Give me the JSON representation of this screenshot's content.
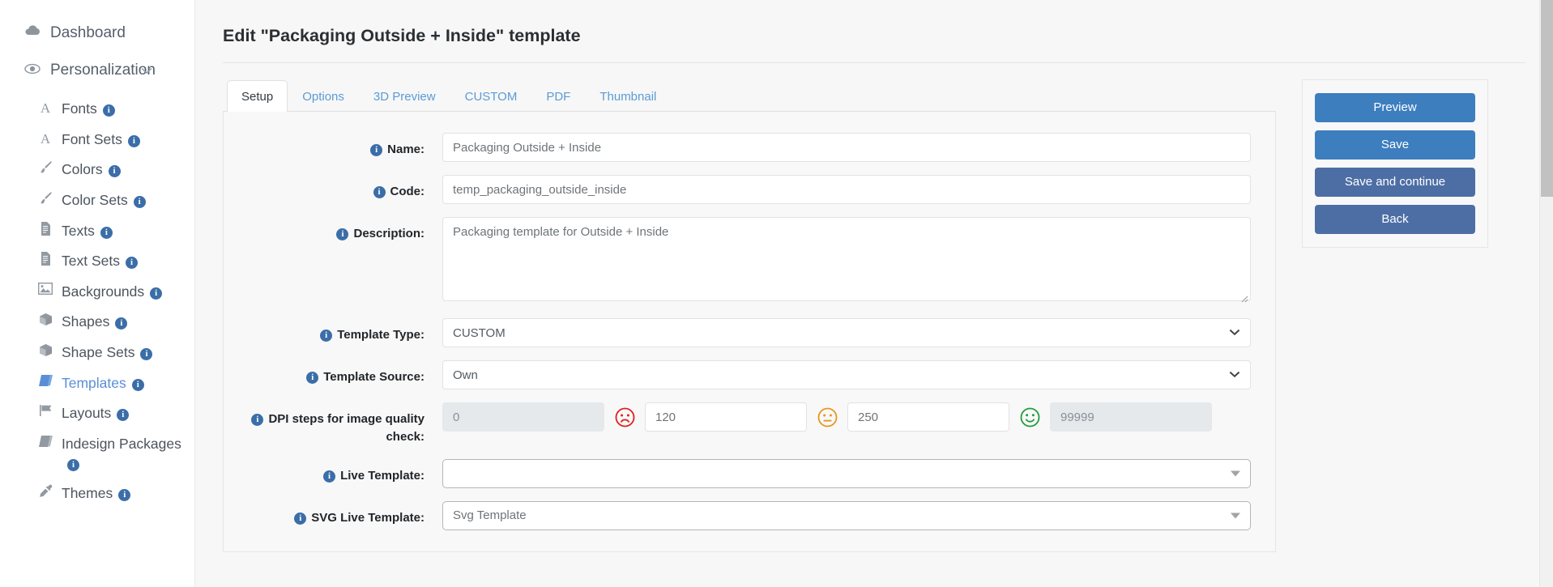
{
  "sidebar": {
    "dashboard": {
      "label": "Dashboard",
      "icon": "cloud-icon"
    },
    "personalization": {
      "label": "Personalization",
      "icon": "eye-icon",
      "chevron": "chevron-down-icon"
    },
    "items": [
      {
        "label": "Fonts",
        "icon": "font-letter-icon",
        "info": true,
        "active": false
      },
      {
        "label": "Font Sets",
        "icon": "font-letter-icon",
        "info": true,
        "active": false
      },
      {
        "label": "Colors",
        "icon": "brush-icon",
        "info": true,
        "active": false
      },
      {
        "label": "Color Sets",
        "icon": "brush-icon",
        "info": true,
        "active": false
      },
      {
        "label": "Texts",
        "icon": "document-icon",
        "info": true,
        "active": false
      },
      {
        "label": "Text Sets",
        "icon": "document-icon",
        "info": true,
        "active": false
      },
      {
        "label": "Backgrounds",
        "icon": "image-icon",
        "info": true,
        "active": false
      },
      {
        "label": "Shapes",
        "icon": "cube-icon",
        "info": true,
        "active": false
      },
      {
        "label": "Shape Sets",
        "icon": "cube-icon",
        "info": true,
        "active": false
      },
      {
        "label": "Templates",
        "icon": "book-icon",
        "info": true,
        "active": true
      },
      {
        "label": "Layouts",
        "icon": "flag-icon",
        "info": true,
        "active": false
      },
      {
        "label": "Indesign Packages",
        "icon": "book-icon",
        "info": true,
        "active": false
      },
      {
        "label": "Themes",
        "icon": "eyedropper-icon",
        "info": true,
        "active": false
      }
    ]
  },
  "header": {
    "title": "Edit \"Packaging Outside + Inside\" template"
  },
  "tabs": [
    {
      "label": "Setup",
      "active": true
    },
    {
      "label": "Options",
      "active": false
    },
    {
      "label": "3D Preview",
      "active": false
    },
    {
      "label": "CUSTOM",
      "active": false
    },
    {
      "label": "PDF",
      "active": false
    },
    {
      "label": "Thumbnail",
      "active": false
    }
  ],
  "form": {
    "name": {
      "label": "Name:",
      "value": "Packaging Outside + Inside"
    },
    "code": {
      "label": "Code:",
      "value": "temp_packaging_outside_inside"
    },
    "description": {
      "label": "Description:",
      "value": "Packaging template for Outside + Inside"
    },
    "template_type": {
      "label": "Template Type:",
      "value": "CUSTOM"
    },
    "template_source": {
      "label": "Template Source:",
      "value": "Own"
    },
    "dpi": {
      "label": "DPI steps for image quality check:",
      "min_value": "0",
      "low_value": "120",
      "mid_value": "250",
      "max_value": "99999",
      "faces": [
        "sad-face-icon",
        "neutral-face-icon",
        "happy-face-icon"
      ],
      "face_colors": [
        "#e02020",
        "#e8961e",
        "#1f9e3e"
      ]
    },
    "live_template": {
      "label": "Live Template:",
      "value": ""
    },
    "svg_live_template": {
      "label": "SVG Live Template:",
      "value": "Svg Template"
    }
  },
  "actions": {
    "preview": "Preview",
    "save": "Save",
    "save_and_continue": "Save and continue",
    "back": "Back"
  },
  "colors": {
    "primary_button": "#3d7ebf",
    "secondary_button": "#4d6ea5",
    "active_link": "#5a8fd6",
    "info_badge": "#3b6ea8"
  }
}
